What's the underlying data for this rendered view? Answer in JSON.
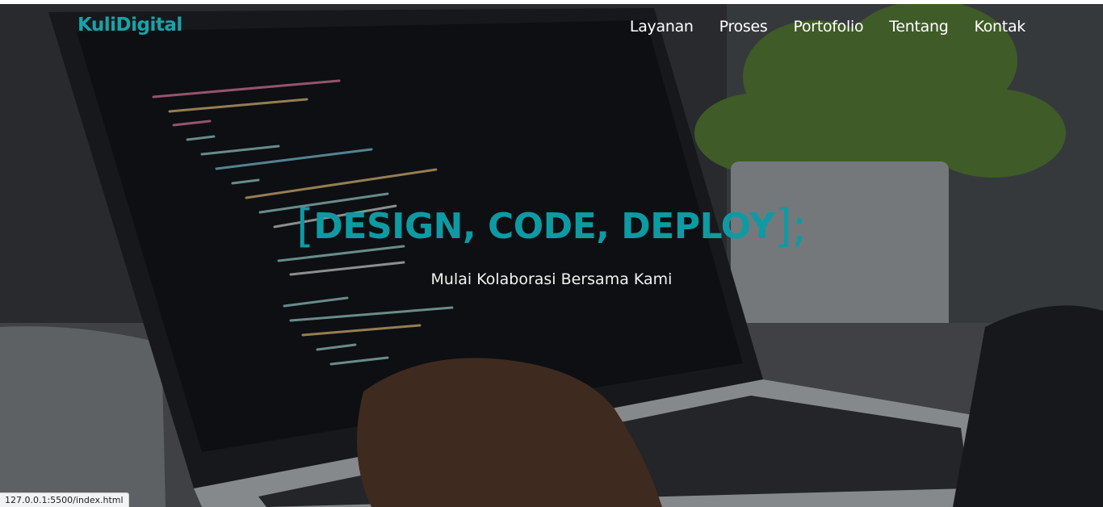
{
  "brand": {
    "name": "KuliDigital",
    "color": "#1aa3a8"
  },
  "nav": {
    "links": [
      "Layanan",
      "Proses",
      "Portofolio",
      "Tentang",
      "Kontak"
    ]
  },
  "hero": {
    "bracket_open": "[",
    "headline": "DESIGN, CODE, DEPLOY",
    "bracket_close": "];",
    "headline_color": "#0e9aa3",
    "subline": "Mulai Kolaborasi Bersama Kami"
  },
  "status_bar": {
    "url": "127.0.0.1:5500/index.html"
  }
}
